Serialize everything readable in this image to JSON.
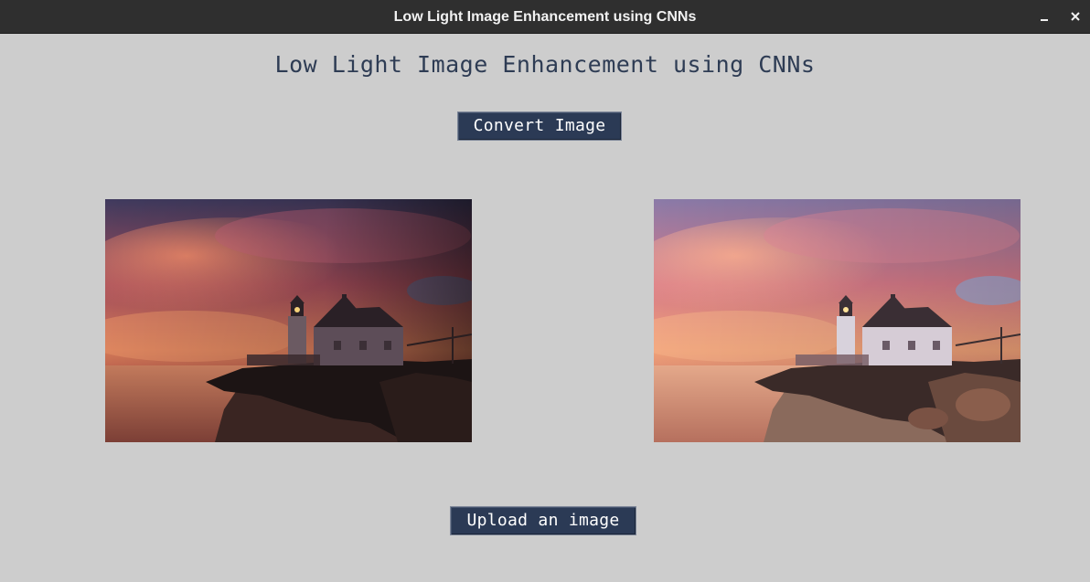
{
  "window": {
    "title": "Low Light Image Enhancement using CNNs",
    "minimize_icon": "minimize-icon",
    "close_icon": "close-icon"
  },
  "app": {
    "heading": "Low Light Image Enhancement using CNNs",
    "convert_button_label": "Convert Image",
    "upload_button_label": "Upload an image"
  },
  "images": {
    "input_subject": "lighthouse at sunset (low light)",
    "output_subject": "lighthouse at sunset (enhanced)"
  },
  "colors": {
    "background": "#cdcdcd",
    "titlebar": "#2f2f2f",
    "heading_text": "#2e3c54",
    "button_bg": "#2b3a55",
    "button_text": "#ffffff"
  }
}
